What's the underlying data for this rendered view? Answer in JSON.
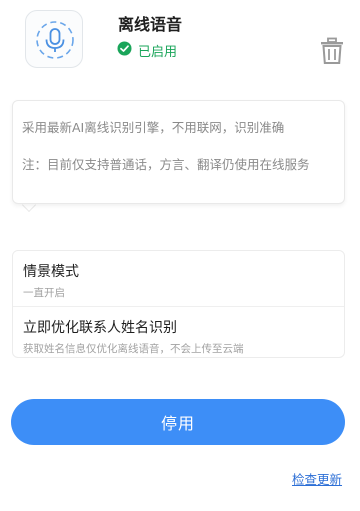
{
  "header": {
    "icon": "microphone-icon",
    "title": "离线语音",
    "status": "已启用",
    "status_icon": "check-circle-icon",
    "delete_icon": "trash-icon"
  },
  "description": {
    "line1": "采用最新AI离线识别引擎，不用联网，识别准确",
    "line2": "注：目前仅支持普通话，方言、翻译仍使用在线服务"
  },
  "settings": [
    {
      "name": "情景模式",
      "sub": "一直开启"
    },
    {
      "name": "立即优化联系人姓名识别",
      "sub": "获取姓名信息仅优化离线语音，不会上传至云端"
    }
  ],
  "actions": {
    "disable_label": "停用",
    "check_update_label": "检查更新"
  },
  "colors": {
    "accent": "#3d8ef7",
    "status_green": "#1aa55a",
    "link_blue": "#2d6fd6"
  }
}
